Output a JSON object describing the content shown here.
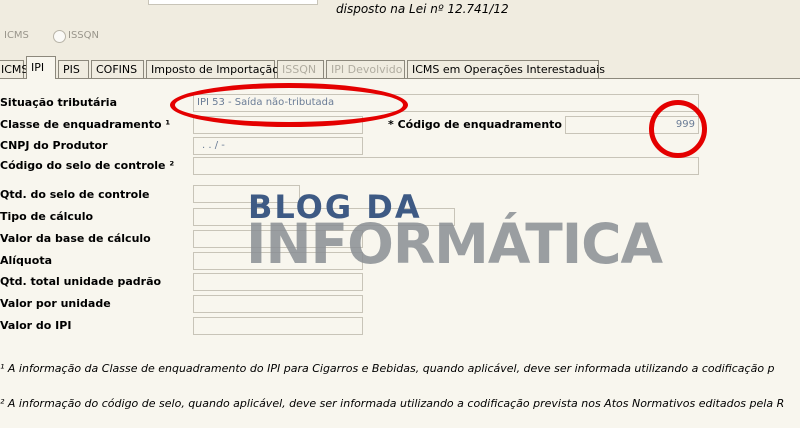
{
  "header": {
    "law_text": "disposto na Lei nº 12.741/12"
  },
  "radios": [
    {
      "label": "ICMS"
    },
    {
      "label": "ISSQN"
    }
  ],
  "tabs": [
    {
      "label": "ICMS",
      "state": "normal"
    },
    {
      "label": "IPI",
      "state": "active"
    },
    {
      "label": "PIS",
      "state": "normal"
    },
    {
      "label": "COFINS",
      "state": "normal"
    },
    {
      "label": "Imposto de Importação",
      "state": "normal"
    },
    {
      "label": "ISSQN",
      "state": "disabled"
    },
    {
      "label": "IPI Devolvido",
      "state": "disabled"
    },
    {
      "label": "ICMS em Operações Interestaduais",
      "state": "normal"
    }
  ],
  "form": {
    "situacao": {
      "label": "Situação tributária",
      "value": "IPI 53 - Saída não-tributada"
    },
    "classe": {
      "label": "Classe de enquadramento ¹",
      "value": ""
    },
    "codigo_enq": {
      "label": "* Código de enquadramento",
      "value": "999"
    },
    "cnpj": {
      "label": "CNPJ do Produtor",
      "value": ". . / -"
    },
    "selo": {
      "label": "Código do selo de controle ²",
      "value": ""
    },
    "qtd_selo": {
      "label": "Qtd. do selo de controle",
      "value": ""
    },
    "tipo_calculo": {
      "label": "Tipo de cálculo",
      "value": ""
    },
    "base_calculo": {
      "label": "Valor da base de cálculo",
      "value": ""
    },
    "aliquota": {
      "label": "Alíquota",
      "value": ""
    },
    "qtd_total": {
      "label": "Qtd. total unidade padrão",
      "value": ""
    },
    "valor_unidade": {
      "label": "Valor por unidade",
      "value": ""
    },
    "valor_ipi": {
      "label": "Valor do IPI",
      "value": ""
    }
  },
  "notes": {
    "note1": "¹ A informação da Classe de enquadramento do IPI para Cigarros e Bebidas, quando aplicável, deve ser informada utilizando a codificação p",
    "note2": "² A informação do código de selo, quando aplicável, deve ser informada utilizando a codificação prevista nos Atos Normativos editados pela R"
  },
  "watermark": {
    "line1": "BLOG DA",
    "line2": "INFORMÁTICA"
  },
  "colors": {
    "annotation_red": "#e40000",
    "watermark_blue": "#3e5a84",
    "watermark_gray": "#8a8f94"
  }
}
